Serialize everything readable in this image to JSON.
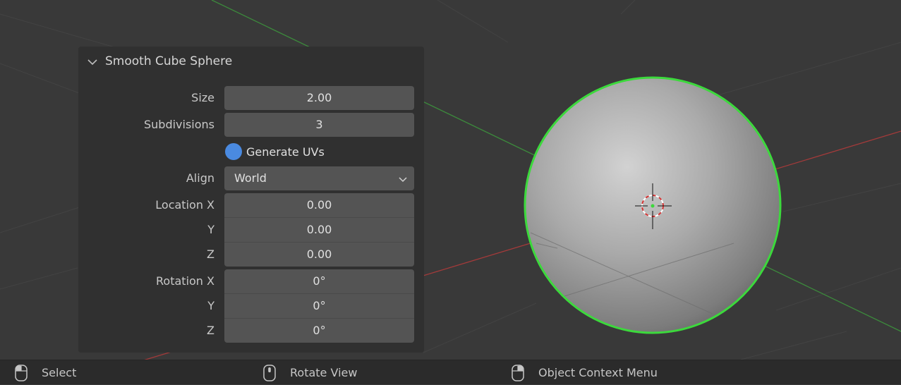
{
  "operator_panel": {
    "title": "Smooth Cube Sphere",
    "size": {
      "label": "Size",
      "value": "2.00"
    },
    "subdivisions": {
      "label": "Subdivisions",
      "value": "3"
    },
    "generate_uvs": {
      "label": "Generate UVs",
      "checked": true
    },
    "align": {
      "label": "Align",
      "value": "World"
    },
    "location": {
      "label": "Location X",
      "x": "0.00",
      "y_label": "Y",
      "y": "0.00",
      "z_label": "Z",
      "z": "0.00"
    },
    "rotation": {
      "label": "Rotation X",
      "x": "0°",
      "y_label": "Y",
      "y": "0°",
      "z_label": "Z",
      "z": "0°"
    }
  },
  "status_bar": {
    "hints": [
      {
        "icon": "mouse-left-icon",
        "label": "Select"
      },
      {
        "icon": "mouse-middle-icon",
        "label": "Rotate View"
      },
      {
        "icon": "mouse-right-icon",
        "label": "Object Context Menu"
      }
    ]
  },
  "colors": {
    "viewport_bg": "#393939",
    "panel_bg": "#303030",
    "field_bg": "#545454",
    "toggle_on": "#4a8ae0",
    "selection_outline": "#3cd93c",
    "x_axis": "#a33a3a",
    "y_axis": "#3c8a3c",
    "status_bg": "#2b2b2b"
  }
}
